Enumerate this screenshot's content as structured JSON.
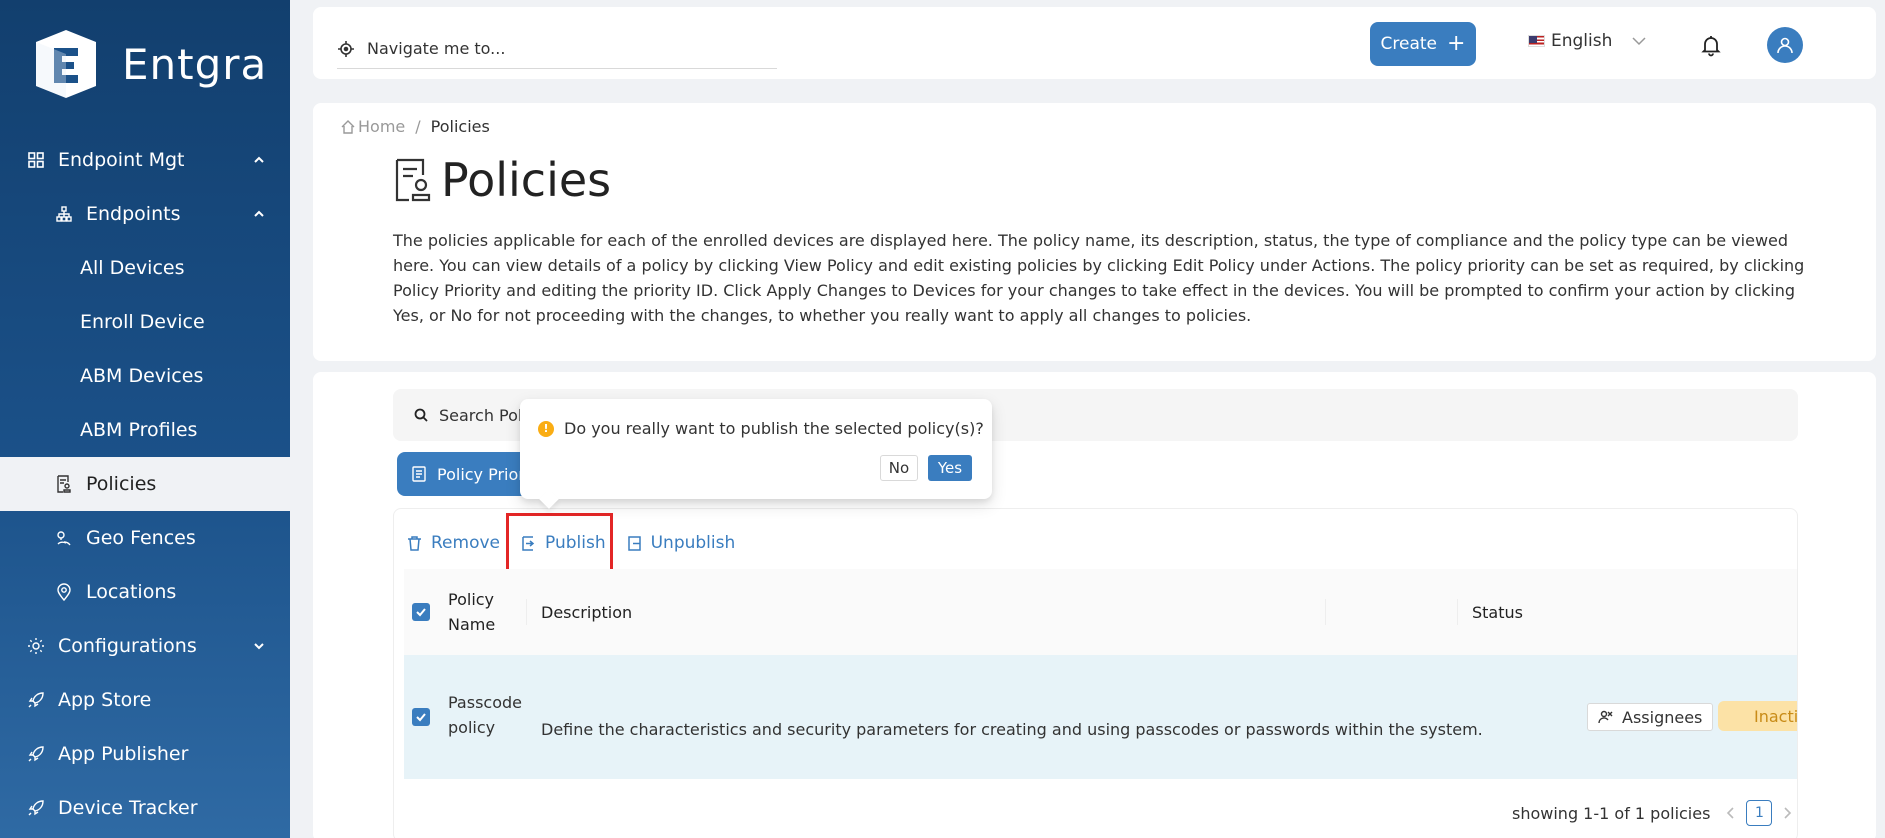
{
  "brand": {
    "name": "Entgra"
  },
  "sidebar": {
    "items": [
      {
        "label": "Endpoint Mgt",
        "icon": "grid-icon"
      },
      {
        "label": "Endpoints",
        "icon": "hierarchy-icon"
      },
      {
        "label": "All Devices"
      },
      {
        "label": "Enroll Device"
      },
      {
        "label": "ABM Devices"
      },
      {
        "label": "ABM Profiles"
      },
      {
        "label": "Policies",
        "icon": "policy-icon"
      },
      {
        "label": "Geo Fences",
        "icon": "geofence-icon"
      },
      {
        "label": "Locations",
        "icon": "location-icon"
      },
      {
        "label": "Configurations",
        "icon": "gear-icon"
      },
      {
        "label": "App Store",
        "icon": "rocket-icon"
      },
      {
        "label": "App Publisher",
        "icon": "rocket-icon"
      },
      {
        "label": "Device Tracker",
        "icon": "rocket-icon"
      }
    ]
  },
  "topbar": {
    "nav_placeholder": "Navigate me to...",
    "create_label": "Create",
    "language": "English"
  },
  "header": {
    "breadcrumb_home": "Home",
    "breadcrumb_current": "Policies",
    "title": "Policies",
    "description": "The policies applicable for each of the enrolled devices are displayed here. The policy name, its description, status, the type of compliance and the policy type can be viewed here. You can view details of a policy by clicking View Policy and edit existing policies by clicking Edit Policy under Actions. The policy priority can be set as required, by clicking Policy Priority and editing the priority ID. Click Apply Changes to Devices for your changes to take effect in the devices. You will be prompted to confirm your action by clicking Yes, or No for not proceeding with the changes, to whether you really want to apply all changes to policies."
  },
  "content": {
    "search_placeholder": "Search Pol",
    "priority_button": "Policy Priority",
    "actions": {
      "remove": "Remove",
      "publish": "Publish",
      "unpublish": "Unpublish"
    },
    "table": {
      "headers": {
        "name_line1": "Policy",
        "name_line2": "Name",
        "description": "Description",
        "status": "Status"
      },
      "rows": [
        {
          "name_line1": "Passcode",
          "name_line2": "policy",
          "description": "Define the characteristics and security parameters for creating and using passcodes or passwords within the system.",
          "assignees": "Assignees",
          "status": "Inactive"
        }
      ]
    },
    "pagination": {
      "summary": "showing 1-1 of 1 policies",
      "page": "1"
    }
  },
  "popconfirm": {
    "message": "Do you really want to publish the selected policy(s)?",
    "no": "No",
    "yes": "Yes"
  },
  "colors": {
    "primary": "#3a7dbf",
    "sidebar": "#1b5189",
    "highlight": "#e32626",
    "warning": "#faad14",
    "inactive_bg": "#fce2a6"
  }
}
